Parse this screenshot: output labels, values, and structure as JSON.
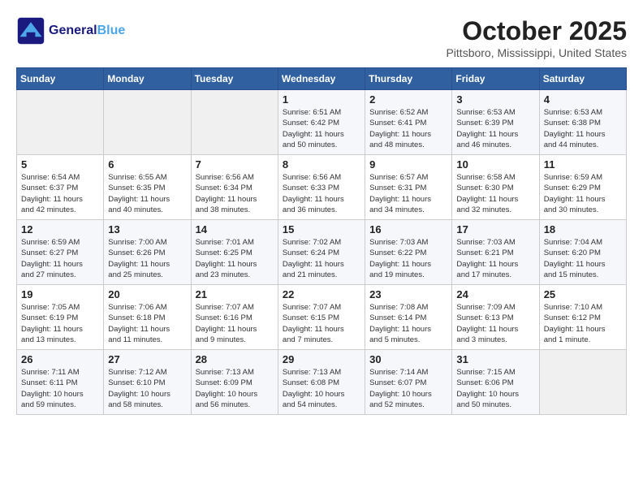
{
  "header": {
    "logo_line1": "General",
    "logo_line2": "Blue",
    "month": "October 2025",
    "location": "Pittsboro, Mississippi, United States"
  },
  "days_of_week": [
    "Sunday",
    "Monday",
    "Tuesday",
    "Wednesday",
    "Thursday",
    "Friday",
    "Saturday"
  ],
  "weeks": [
    [
      {
        "day": "",
        "info": ""
      },
      {
        "day": "",
        "info": ""
      },
      {
        "day": "",
        "info": ""
      },
      {
        "day": "1",
        "info": "Sunrise: 6:51 AM\nSunset: 6:42 PM\nDaylight: 11 hours\nand 50 minutes."
      },
      {
        "day": "2",
        "info": "Sunrise: 6:52 AM\nSunset: 6:41 PM\nDaylight: 11 hours\nand 48 minutes."
      },
      {
        "day": "3",
        "info": "Sunrise: 6:53 AM\nSunset: 6:39 PM\nDaylight: 11 hours\nand 46 minutes."
      },
      {
        "day": "4",
        "info": "Sunrise: 6:53 AM\nSunset: 6:38 PM\nDaylight: 11 hours\nand 44 minutes."
      }
    ],
    [
      {
        "day": "5",
        "info": "Sunrise: 6:54 AM\nSunset: 6:37 PM\nDaylight: 11 hours\nand 42 minutes."
      },
      {
        "day": "6",
        "info": "Sunrise: 6:55 AM\nSunset: 6:35 PM\nDaylight: 11 hours\nand 40 minutes."
      },
      {
        "day": "7",
        "info": "Sunrise: 6:56 AM\nSunset: 6:34 PM\nDaylight: 11 hours\nand 38 minutes."
      },
      {
        "day": "8",
        "info": "Sunrise: 6:56 AM\nSunset: 6:33 PM\nDaylight: 11 hours\nand 36 minutes."
      },
      {
        "day": "9",
        "info": "Sunrise: 6:57 AM\nSunset: 6:31 PM\nDaylight: 11 hours\nand 34 minutes."
      },
      {
        "day": "10",
        "info": "Sunrise: 6:58 AM\nSunset: 6:30 PM\nDaylight: 11 hours\nand 32 minutes."
      },
      {
        "day": "11",
        "info": "Sunrise: 6:59 AM\nSunset: 6:29 PM\nDaylight: 11 hours\nand 30 minutes."
      }
    ],
    [
      {
        "day": "12",
        "info": "Sunrise: 6:59 AM\nSunset: 6:27 PM\nDaylight: 11 hours\nand 27 minutes."
      },
      {
        "day": "13",
        "info": "Sunrise: 7:00 AM\nSunset: 6:26 PM\nDaylight: 11 hours\nand 25 minutes."
      },
      {
        "day": "14",
        "info": "Sunrise: 7:01 AM\nSunset: 6:25 PM\nDaylight: 11 hours\nand 23 minutes."
      },
      {
        "day": "15",
        "info": "Sunrise: 7:02 AM\nSunset: 6:24 PM\nDaylight: 11 hours\nand 21 minutes."
      },
      {
        "day": "16",
        "info": "Sunrise: 7:03 AM\nSunset: 6:22 PM\nDaylight: 11 hours\nand 19 minutes."
      },
      {
        "day": "17",
        "info": "Sunrise: 7:03 AM\nSunset: 6:21 PM\nDaylight: 11 hours\nand 17 minutes."
      },
      {
        "day": "18",
        "info": "Sunrise: 7:04 AM\nSunset: 6:20 PM\nDaylight: 11 hours\nand 15 minutes."
      }
    ],
    [
      {
        "day": "19",
        "info": "Sunrise: 7:05 AM\nSunset: 6:19 PM\nDaylight: 11 hours\nand 13 minutes."
      },
      {
        "day": "20",
        "info": "Sunrise: 7:06 AM\nSunset: 6:18 PM\nDaylight: 11 hours\nand 11 minutes."
      },
      {
        "day": "21",
        "info": "Sunrise: 7:07 AM\nSunset: 6:16 PM\nDaylight: 11 hours\nand 9 minutes."
      },
      {
        "day": "22",
        "info": "Sunrise: 7:07 AM\nSunset: 6:15 PM\nDaylight: 11 hours\nand 7 minutes."
      },
      {
        "day": "23",
        "info": "Sunrise: 7:08 AM\nSunset: 6:14 PM\nDaylight: 11 hours\nand 5 minutes."
      },
      {
        "day": "24",
        "info": "Sunrise: 7:09 AM\nSunset: 6:13 PM\nDaylight: 11 hours\nand 3 minutes."
      },
      {
        "day": "25",
        "info": "Sunrise: 7:10 AM\nSunset: 6:12 PM\nDaylight: 11 hours\nand 1 minute."
      }
    ],
    [
      {
        "day": "26",
        "info": "Sunrise: 7:11 AM\nSunset: 6:11 PM\nDaylight: 10 hours\nand 59 minutes."
      },
      {
        "day": "27",
        "info": "Sunrise: 7:12 AM\nSunset: 6:10 PM\nDaylight: 10 hours\nand 58 minutes."
      },
      {
        "day": "28",
        "info": "Sunrise: 7:13 AM\nSunset: 6:09 PM\nDaylight: 10 hours\nand 56 minutes."
      },
      {
        "day": "29",
        "info": "Sunrise: 7:13 AM\nSunset: 6:08 PM\nDaylight: 10 hours\nand 54 minutes."
      },
      {
        "day": "30",
        "info": "Sunrise: 7:14 AM\nSunset: 6:07 PM\nDaylight: 10 hours\nand 52 minutes."
      },
      {
        "day": "31",
        "info": "Sunrise: 7:15 AM\nSunset: 6:06 PM\nDaylight: 10 hours\nand 50 minutes."
      },
      {
        "day": "",
        "info": ""
      }
    ]
  ]
}
